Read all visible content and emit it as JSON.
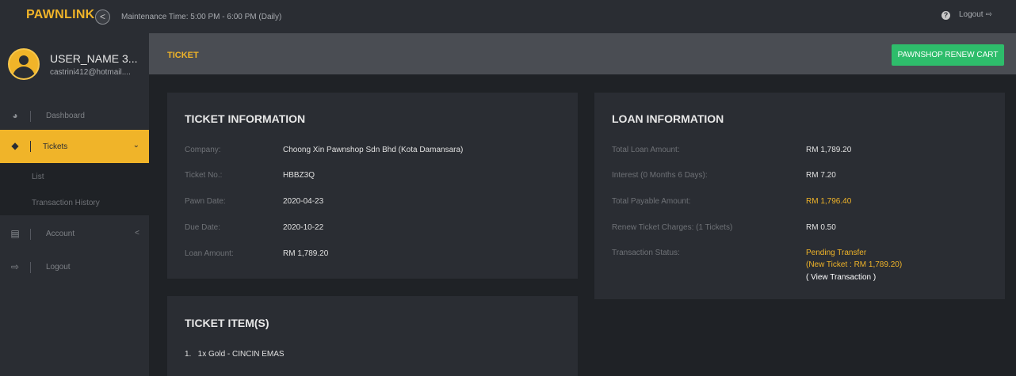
{
  "topbar": {
    "brand": "PAWNLINK",
    "collapse_icon": "<",
    "maintenance": "Maintenance Time: 5:00 PM - 6:00 PM (Daily)",
    "help_icon": "?",
    "logout_label": "Logout",
    "logout_icon": "⇨"
  },
  "user": {
    "name": "USER_NAME 3...",
    "email": "castrini412@hotmail...."
  },
  "sidebar": {
    "items": [
      {
        "label": "Dashboard",
        "icon": "dashboard-icon",
        "glyph": "◕"
      },
      {
        "label": "Tickets",
        "icon": "ticket-icon",
        "glyph": "◆",
        "chevron": "⌄"
      },
      {
        "label": "Account",
        "icon": "id-card-icon",
        "glyph": "▤",
        "chevron": "<"
      },
      {
        "label": "Logout",
        "icon": "logout-icon",
        "glyph": "⇨"
      }
    ],
    "submenu": [
      "List",
      "Transaction History"
    ]
  },
  "header": {
    "title": "TICKET",
    "renew_button": "PAWNSHOP RENEW CART"
  },
  "ticket_info": {
    "title": "TICKET INFORMATION",
    "rows": [
      {
        "label": "Company:",
        "value": "Choong Xin Pawnshop Sdn Bhd (Kota Damansara)"
      },
      {
        "label": "Ticket No.:",
        "value": "HBBZ3Q"
      },
      {
        "label": "Pawn Date:",
        "value": "2020-04-23"
      },
      {
        "label": "Due Date:",
        "value": "2020-10-22"
      },
      {
        "label": "Loan Amount:",
        "value": "RM 1,789.20"
      }
    ]
  },
  "loan_info": {
    "title": "LOAN INFORMATION",
    "rows": [
      {
        "label": "Total Loan Amount:",
        "value": "RM 1,789.20"
      },
      {
        "label": "Interest (0 Months 6 Days):",
        "value": "RM 7.20"
      },
      {
        "label": "Total Payable Amount:",
        "value": "RM 1,796.40"
      },
      {
        "label": "Renew Ticket Charges: (1 Tickets)",
        "value": "RM 0.50"
      },
      {
        "label": "Transaction Status:",
        "value": "Pending Transfer"
      }
    ],
    "status_detail": "(New Ticket : RM 1,789.20)",
    "view_transaction": "( View Transaction )"
  },
  "ticket_items": {
    "title": "TICKET ITEM(S)",
    "items": [
      "1.   1x Gold - CINCIN EMAS"
    ]
  },
  "colors": {
    "accent": "#f0b429",
    "success": "#2ebd6b",
    "background": "#1f2226",
    "panel": "#2a2d33"
  }
}
